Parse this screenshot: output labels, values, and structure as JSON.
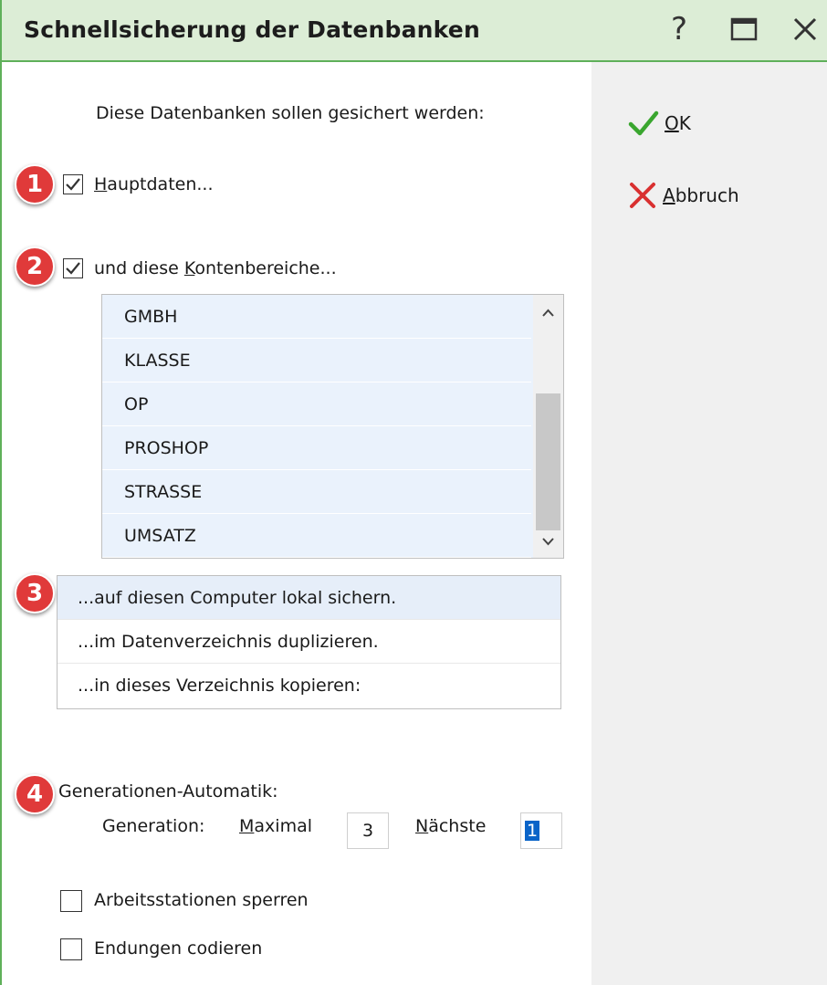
{
  "window": {
    "title": "Schnellsicherung der Datenbanken",
    "help_glyph": "?",
    "border_color": "#5fb05a",
    "title_bg": "#dcedd6"
  },
  "main": {
    "intro": "Diese Datenbanken sollen gesichert werden:",
    "hauptdaten": {
      "label_rest": "auptdaten...",
      "mnemonic": "H",
      "checked": true
    },
    "konten": {
      "label_pre": "und diese ",
      "mnemonic": "K",
      "label_rest": "ontenbereiche...",
      "checked": true
    },
    "konten_list": [
      "GMBH",
      "KLASSE",
      "OP",
      "PROSHOP",
      "STRASSE",
      "UMSATZ"
    ],
    "targets": [
      "...auf diesen Computer lokal sichern.",
      "...im Datenverzeichnis duplizieren.",
      "...in dieses Verzeichnis kopieren:"
    ],
    "generationen_title": "Generationen-Automatik:",
    "generation_label": "Generation:",
    "maximal": {
      "mnemonic": "M",
      "label_rest": "aximal",
      "value": "3"
    },
    "naechste": {
      "mnemonic": "N",
      "label_rest": "ächste",
      "value": "1"
    },
    "arbeitsstationen": {
      "label": "Arbeitsstationen sperren",
      "checked": false
    },
    "endungen": {
      "label": "Endungen codieren",
      "checked": false
    }
  },
  "badges": [
    "1",
    "2",
    "3",
    "4"
  ],
  "actions": {
    "ok": {
      "mnemonic": "O",
      "label_rest": "K",
      "icon": "checkmark-icon",
      "color": "#3aa62f"
    },
    "abbruch": {
      "mnemonic": "A",
      "label_rest": "bbruch",
      "icon": "cross-icon",
      "color": "#d93030"
    }
  }
}
